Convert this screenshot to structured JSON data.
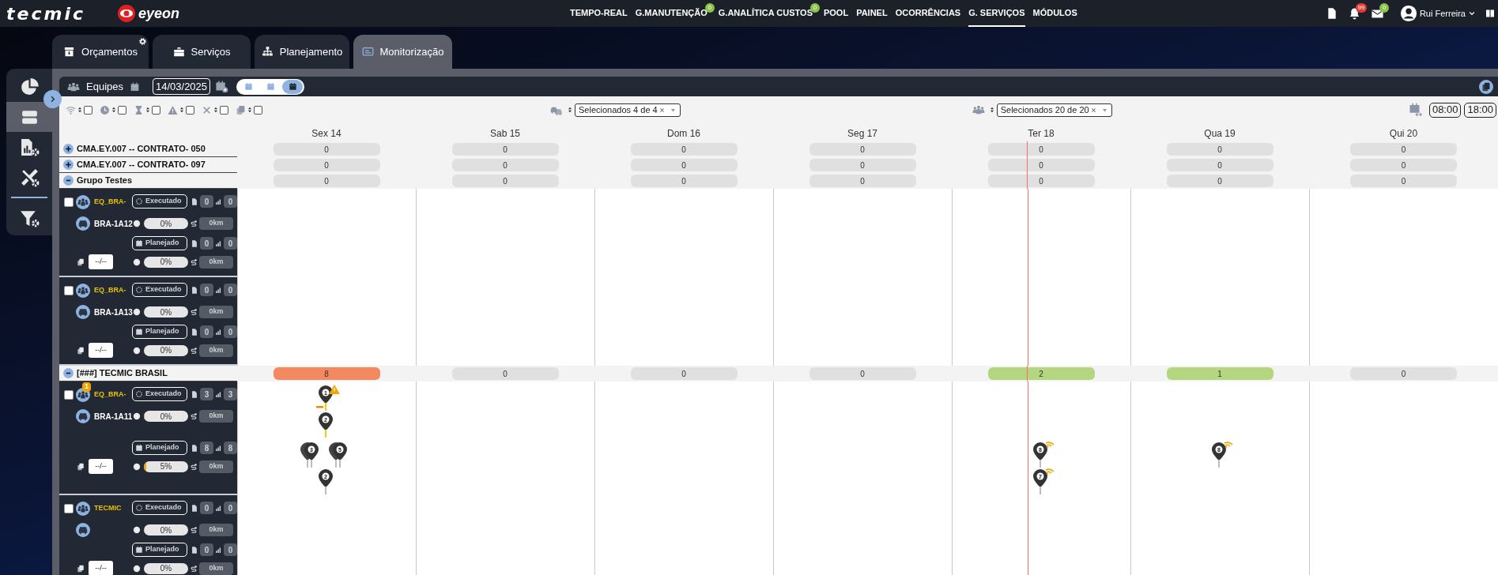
{
  "header": {
    "logo_primary": "tecmic",
    "logo_secondary": "eyeon",
    "nav": [
      {
        "label": "TEMPO-REAL",
        "selected": false
      },
      {
        "label": "G.MANUTENÇÃO",
        "selected": false,
        "badge": "0"
      },
      {
        "label": "G.ANALÍTICA CUSTOS",
        "selected": false,
        "badge": "0"
      },
      {
        "label": "POOL",
        "selected": false
      },
      {
        "label": "PAINEL",
        "selected": false
      },
      {
        "label": "OCORRÊNCIAS",
        "selected": false
      },
      {
        "label": "G. SERVIÇOS",
        "selected": true
      },
      {
        "label": "MÓDULOS",
        "selected": false
      }
    ],
    "notifications": "99",
    "messages": "0",
    "user": "Rui Ferreira"
  },
  "tabs": [
    {
      "label": "Orçamentos",
      "kind": "budget",
      "selected": false,
      "settings": true
    },
    {
      "label": "Serviços",
      "kind": "services",
      "selected": false,
      "settings": false
    },
    {
      "label": "Planejamento",
      "kind": "planning",
      "selected": false,
      "settings": false
    },
    {
      "label": "Monitorização",
      "kind": "monitor",
      "selected": true,
      "settings": false
    }
  ],
  "sidebar": {
    "items": [
      {
        "kind": "pie",
        "selected": false
      },
      {
        "kind": "server",
        "selected": true
      },
      {
        "kind": "report",
        "selected": false
      },
      {
        "kind": "tools",
        "selected": false
      },
      {
        "kind": "filter",
        "selected": false
      }
    ]
  },
  "toolbar": {
    "label": "Equipes",
    "date": "14/03/2025",
    "views": [
      {
        "selected": false
      },
      {
        "selected": false
      },
      {
        "selected": true
      }
    ]
  },
  "filters": [
    {
      "kind": "wifi",
      "checked": false
    },
    {
      "kind": "clock",
      "checked": false
    },
    {
      "kind": "hourglass",
      "checked": false
    },
    {
      "kind": "warning",
      "checked": false
    },
    {
      "kind": "close",
      "checked": false
    },
    {
      "kind": "copy",
      "checked": false
    }
  ],
  "vehicle_select": "Selecionados 4 de 4",
  "team_select": "Selecionados 20 de 20",
  "shift_start": "08:00",
  "shift_end": "18:00",
  "days": [
    "Sex 14",
    "Sab 15",
    "Dom 16",
    "Seg 17",
    "Ter 18",
    "Qua 19",
    "Qui 20"
  ],
  "groups": [
    {
      "label": "CMA.EY.007 -- CONTRATO- 050",
      "expanded": false,
      "counts": [
        {
          "value": "0",
          "color": "#e0e0e0",
          "now": false
        },
        {
          "value": "0",
          "color": "#e0e0e0",
          "now": false
        },
        {
          "value": "0",
          "color": "#e0e0e0",
          "now": false
        },
        {
          "value": "0",
          "color": "#e0e0e0",
          "now": false
        },
        {
          "value": "0",
          "color": "#e0e0e0",
          "now": true
        },
        {
          "value": "0",
          "color": "#e0e0e0",
          "now": false
        },
        {
          "value": "0",
          "color": "#e0e0e0",
          "now": false
        }
      ]
    },
    {
      "label": "CMA.EY.007 -- CONTRATO- 097",
      "expanded": false,
      "counts": [
        {
          "value": "0",
          "color": "#e0e0e0",
          "now": false
        },
        {
          "value": "0",
          "color": "#e0e0e0",
          "now": false
        },
        {
          "value": "0",
          "color": "#e0e0e0",
          "now": false
        },
        {
          "value": "0",
          "color": "#e0e0e0",
          "now": false
        },
        {
          "value": "0",
          "color": "#e0e0e0",
          "now": true
        },
        {
          "value": "0",
          "color": "#e0e0e0",
          "now": false
        },
        {
          "value": "0",
          "color": "#e0e0e0",
          "now": false
        }
      ]
    },
    {
      "label": "Grupo Testes",
      "expanded": true,
      "counts": [
        {
          "value": "0",
          "color": "#e0e0e0",
          "now": false
        },
        {
          "value": "0",
          "color": "#e0e0e0",
          "now": false
        },
        {
          "value": "0",
          "color": "#e0e0e0",
          "now": false
        },
        {
          "value": "0",
          "color": "#e0e0e0",
          "now": false
        },
        {
          "value": "0",
          "color": "#e0e0e0",
          "now": true
        },
        {
          "value": "0",
          "color": "#e0e0e0",
          "now": false
        },
        {
          "value": "0",
          "color": "#e0e0e0",
          "now": false
        }
      ],
      "teams": [
        {
          "name": "EQ_BRA-",
          "plate": "BRA-1A12",
          "checked": false,
          "date": "--/--",
          "executed": {
            "label": "Executado",
            "docs": "0",
            "stops": "0",
            "progress": "0%",
            "level": 0,
            "distance": "0km"
          },
          "planned": {
            "label": "Planejado",
            "docs": "0",
            "stops": "0",
            "progress": "0%",
            "level": 0,
            "distance": "0km"
          },
          "days": [
            {
              "now": false
            },
            {
              "now": false
            },
            {
              "now": false
            },
            {
              "now": false
            },
            {
              "now": true
            },
            {
              "now": false
            },
            {
              "now": false
            }
          ]
        },
        {
          "name": "EQ_BRA-",
          "plate": "BRA-1A13",
          "checked": false,
          "date": "--/--",
          "executed": {
            "label": "Executado",
            "docs": "0",
            "stops": "0",
            "progress": "0%",
            "level": 0,
            "distance": "0km"
          },
          "planned": {
            "label": "Planejado",
            "docs": "0",
            "stops": "0",
            "progress": "0%",
            "level": 0,
            "distance": "0km"
          },
          "days": [
            {
              "now": false
            },
            {
              "now": false
            },
            {
              "now": false
            },
            {
              "now": false
            },
            {
              "now": true
            },
            {
              "now": false
            },
            {
              "now": false
            }
          ]
        }
      ]
    },
    {
      "label": "[###] TECMIC BRASIL",
      "expanded": true,
      "counts": [
        {
          "value": "8",
          "color": "#f4895f",
          "now": false
        },
        {
          "value": "0",
          "color": "#e0e0e0",
          "now": false
        },
        {
          "value": "0",
          "color": "#e0e0e0",
          "now": false
        },
        {
          "value": "0",
          "color": "#e0e0e0",
          "now": false
        },
        {
          "value": "2",
          "color": "#b3d67f",
          "now": true
        },
        {
          "value": "1",
          "color": "#b3d67f",
          "now": false
        },
        {
          "value": "0",
          "color": "#e0e0e0",
          "now": false
        }
      ],
      "teams": [
        {
          "name": "EQ_BRA-",
          "plate": "BRA-1A11",
          "badge": "1",
          "checked": false,
          "date": "--/--",
          "executed": {
            "label": "Executado",
            "docs": "3",
            "stops": "3",
            "progress": "0%",
            "level": 0.02,
            "distance": "0km"
          },
          "planned": {
            "label": "Planejado",
            "docs": "8",
            "stops": "8",
            "progress": "5%",
            "level": 0.05,
            "distance": "0km"
          },
          "days": [
            {
              "now": false,
              "executed": [
                {
                  "pins": [
                    {
                      "label": "1",
                      "warning": true,
                      "signal": false,
                      "stacked": false
                    }
                  ]
                },
                {
                  "pins": [
                    {
                      "label": "2",
                      "warning": false,
                      "signal": false,
                      "stacked": false
                    }
                  ]
                }
              ],
              "planned": [
                {
                  "pins": [
                    {
                      "label": "3",
                      "warning": false,
                      "signal": false,
                      "stacked": true
                    },
                    {
                      "label": "5",
                      "warning": false,
                      "signal": false,
                      "stacked": true
                    }
                  ]
                },
                {
                  "pins": [
                    {
                      "label": "2",
                      "warning": false,
                      "signal": false,
                      "stacked": false
                    }
                  ]
                }
              ]
            },
            {
              "now": false
            },
            {
              "now": false
            },
            {
              "now": false
            },
            {
              "now": true,
              "planned": [
                {
                  "pins": [
                    {
                      "label": "8",
                      "warning": false,
                      "signal": true,
                      "stacked": false
                    }
                  ]
                },
                {
                  "pins": [
                    {
                      "label": "7",
                      "warning": false,
                      "signal": true,
                      "stacked": false
                    }
                  ]
                }
              ]
            },
            {
              "now": false,
              "planned": [
                {
                  "pins": [
                    {
                      "label": "8",
                      "warning": false,
                      "signal": true,
                      "stacked": false
                    }
                  ]
                }
              ]
            },
            {
              "now": false
            }
          ]
        },
        {
          "name": "TECMIC",
          "checked": false,
          "date": "--/--",
          "executed": {
            "label": "Executado",
            "docs": "0",
            "stops": "0",
            "progress": "0%",
            "level": 0,
            "distance": "0km"
          },
          "planned": {
            "label": "Planejado",
            "docs": "0",
            "stops": "0",
            "progress": "0%",
            "level": 0,
            "distance": "0km"
          },
          "days": [
            {
              "now": false
            },
            {
              "now": false
            },
            {
              "now": false
            },
            {
              "now": false
            },
            {
              "now": true
            },
            {
              "now": false
            },
            {
              "now": false
            }
          ]
        }
      ]
    }
  ]
}
